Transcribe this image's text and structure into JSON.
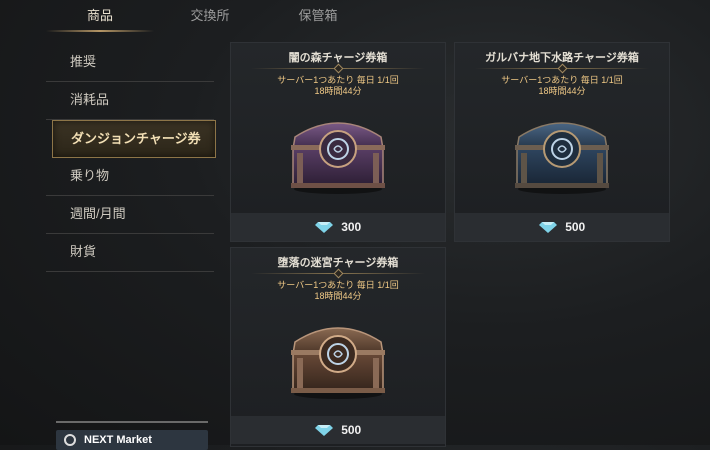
{
  "tabs": [
    {
      "label": "商品",
      "active": true
    },
    {
      "label": "交換所",
      "active": false
    },
    {
      "label": "保管箱",
      "active": false
    }
  ],
  "sidebar": {
    "items": [
      {
        "label": "推奨",
        "active": false
      },
      {
        "label": "消耗品",
        "active": false
      },
      {
        "label": "ダンジョンチャージ券",
        "active": true
      },
      {
        "label": "乗り物",
        "active": false
      },
      {
        "label": "週間/月間",
        "active": false
      },
      {
        "label": "財貨",
        "active": false
      }
    ],
    "bottom_button_label": "NEXT Market"
  },
  "products": [
    {
      "title": "闇の森チャージ券箱",
      "limit": "サーバー1つあたり 毎日 1/1回",
      "time": "18時間44分",
      "price": "300",
      "chest_color": "purple"
    },
    {
      "title": "ガルバナ地下水路チャージ券箱",
      "limit": "サーバー1つあたり 毎日 1/1回",
      "time": "18時間44分",
      "price": "500",
      "chest_color": "blue"
    },
    {
      "title": "堕落の迷宮チャージ券箱",
      "limit": "サーバー1つあたり 毎日 1/1回",
      "time": "18時間44分",
      "price": "500",
      "chest_color": "bronze"
    }
  ],
  "colors": {
    "accent_gold": "#b59665",
    "info_text": "#f0c986",
    "gem": "#7fd3e8"
  }
}
